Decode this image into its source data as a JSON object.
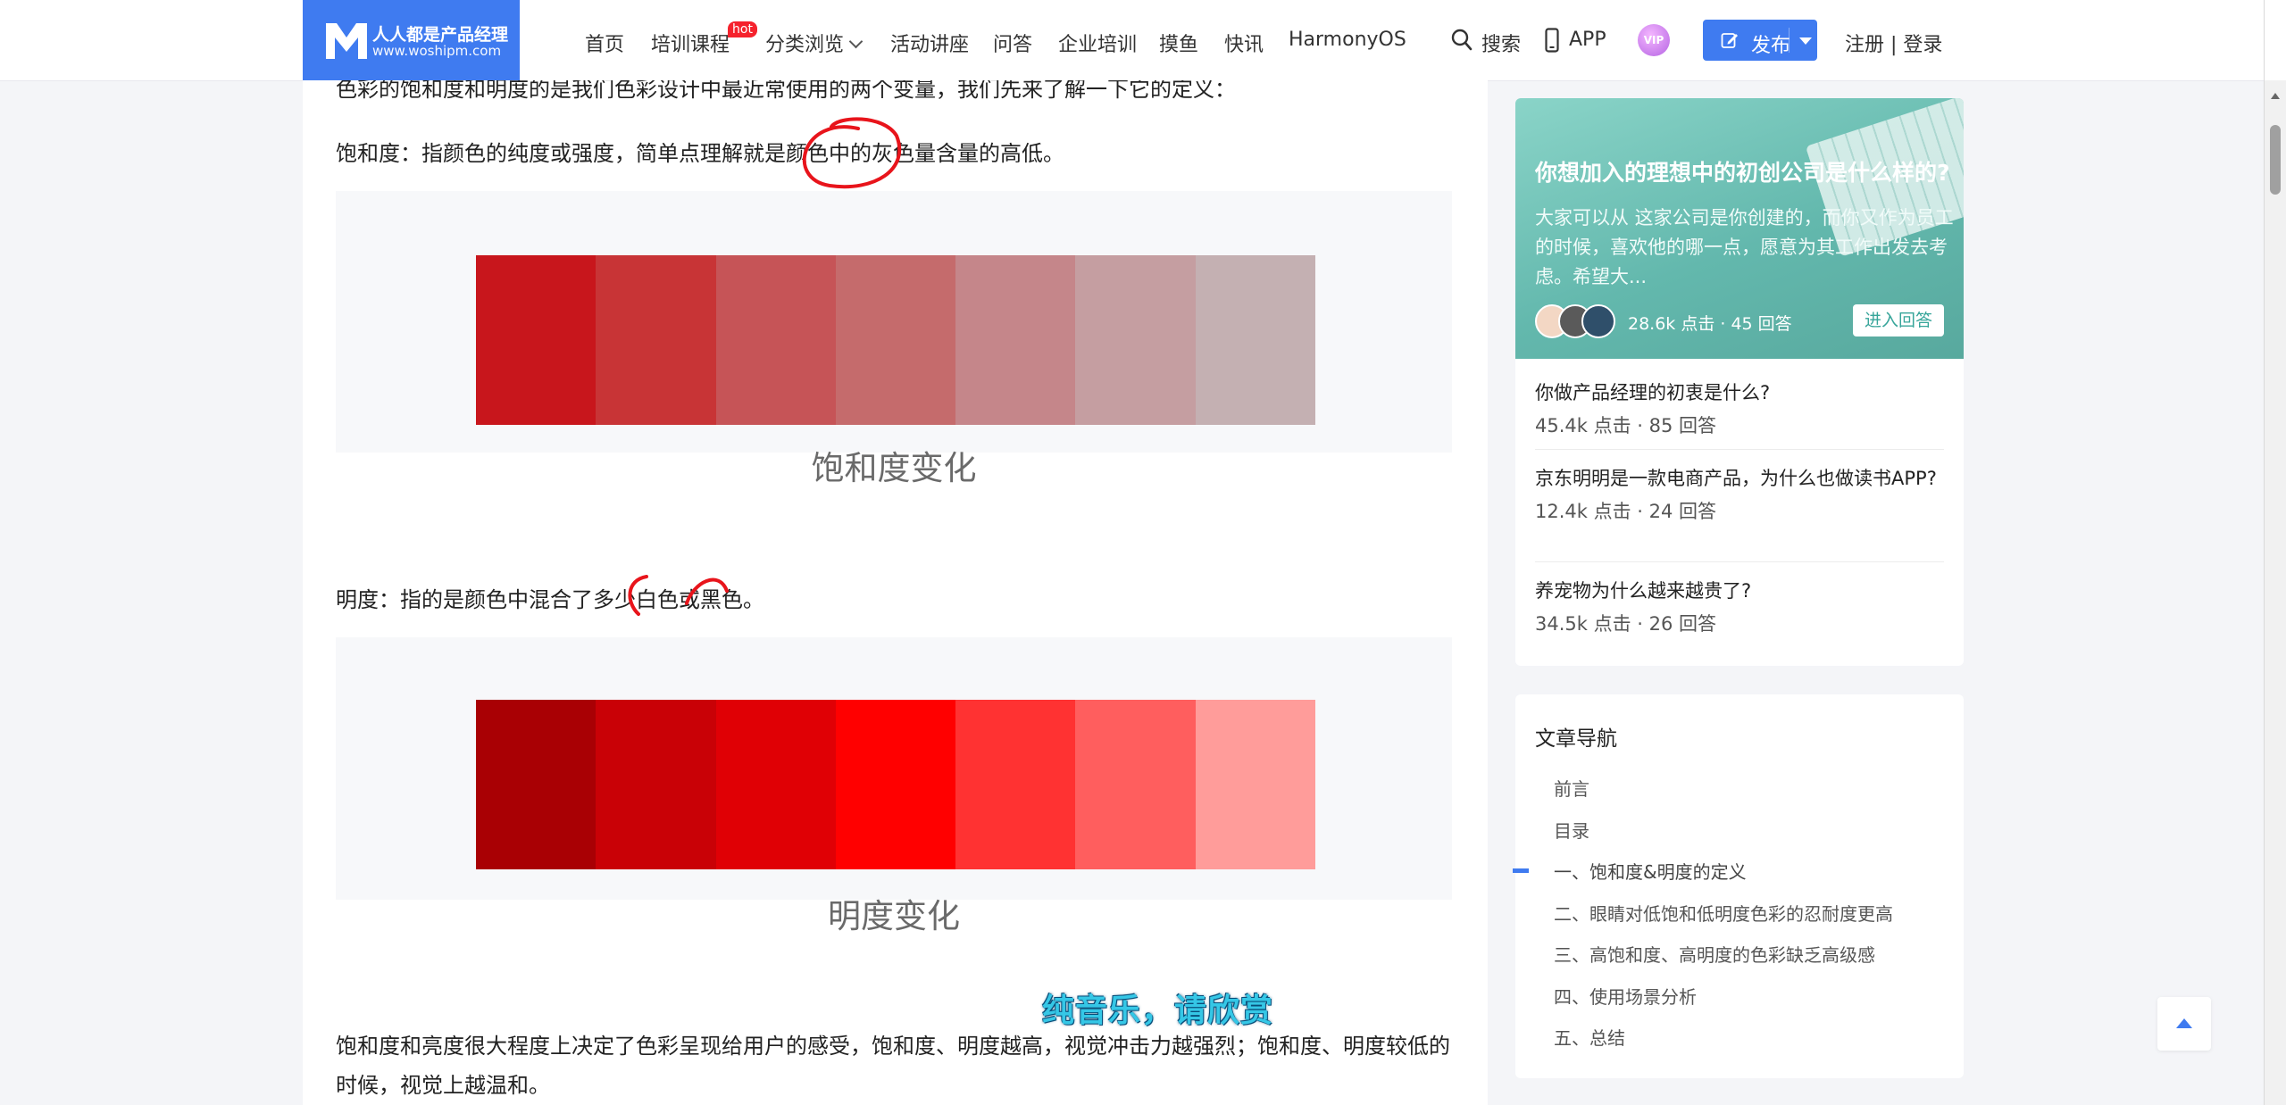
{
  "header": {
    "logo": {
      "name": "人人都是产品经理",
      "url": "www.woshipm.com"
    },
    "nav": [
      "首页",
      "培训课程",
      "分类浏览",
      "活动讲座",
      "问答",
      "企业培训",
      "摸鱼",
      "快讯",
      "HarmonyOS"
    ],
    "hot_badge": "hot",
    "search_label": "搜索",
    "app_label": "APP",
    "vip_label": "VIP",
    "publish_label": "发布",
    "auth_label": "注册 | 登录"
  },
  "article": {
    "intro": "色彩的饱和度和明度的是我们色彩设计中最近常使用的两个变量，我们先来了解一下它的定义：",
    "saturation_def": "饱和度：指颜色的纯度或强度，简单点理解就是颜色中的灰色量含量的高低。",
    "brightness_def": "明度：指的是颜色中混合了多少白色或黑色。",
    "figures": [
      {
        "caption": "饱和度变化",
        "swatches": [
          "#c8161c",
          "#c83436",
          "#c65457",
          "#c56b6c",
          "#c5868a",
          "#c59ea1",
          "#c4b0b2"
        ]
      },
      {
        "caption": "明度变化",
        "swatches": [
          "#a90004",
          "#c90106",
          "#e00005",
          "#ff0000",
          "#ff3232",
          "#ff5e5e",
          "#ff9c9a"
        ]
      }
    ],
    "summary_line1": "饱和度和亮度很大程度上决定了色彩呈现给用户的感受，饱和度、明度越高，视觉冲击力越强烈；饱和度、明度较低的",
    "summary_line2": "时候，视觉上越温和。",
    "subtitle_overlay": "纯音乐，请欣赏"
  },
  "sidebar": {
    "banner": {
      "question": "你想加入的理想中的初创公司是什么样的?",
      "desc": "大家可以从 这家公司是你创建的，而你又作为员工的时候，喜欢他的哪一点，愿意为其工作出发去考虑。希望大...",
      "stats": "28.6k 点击 · 45 回答",
      "answer_button": "进入回答"
    },
    "questions": [
      {
        "title": "你做产品经理的初衷是什么?",
        "stats": "45.4k 点击 · 85 回答"
      },
      {
        "title": "京东明明是一款电商产品，为什么也做读书APP?",
        "stats": "12.4k 点击 · 24 回答"
      },
      {
        "title": "养宠物为什么越来越贵了?",
        "stats": "34.5k 点击 · 26 回答"
      }
    ],
    "toc": {
      "title": "文章导航",
      "items": [
        "前言",
        "目录",
        "一、饱和度&明度的定义",
        "二、眼睛对低饱和低明度色彩的忍耐度更高",
        "三、高饱和度、高明度的色彩缺乏高级感",
        "四、使用场景分析",
        "五、总结"
      ],
      "active_index": 2
    }
  },
  "colors": {
    "accent": "#3f7bf0",
    "hot": "#f5222d",
    "annotation": "#e8141b"
  }
}
